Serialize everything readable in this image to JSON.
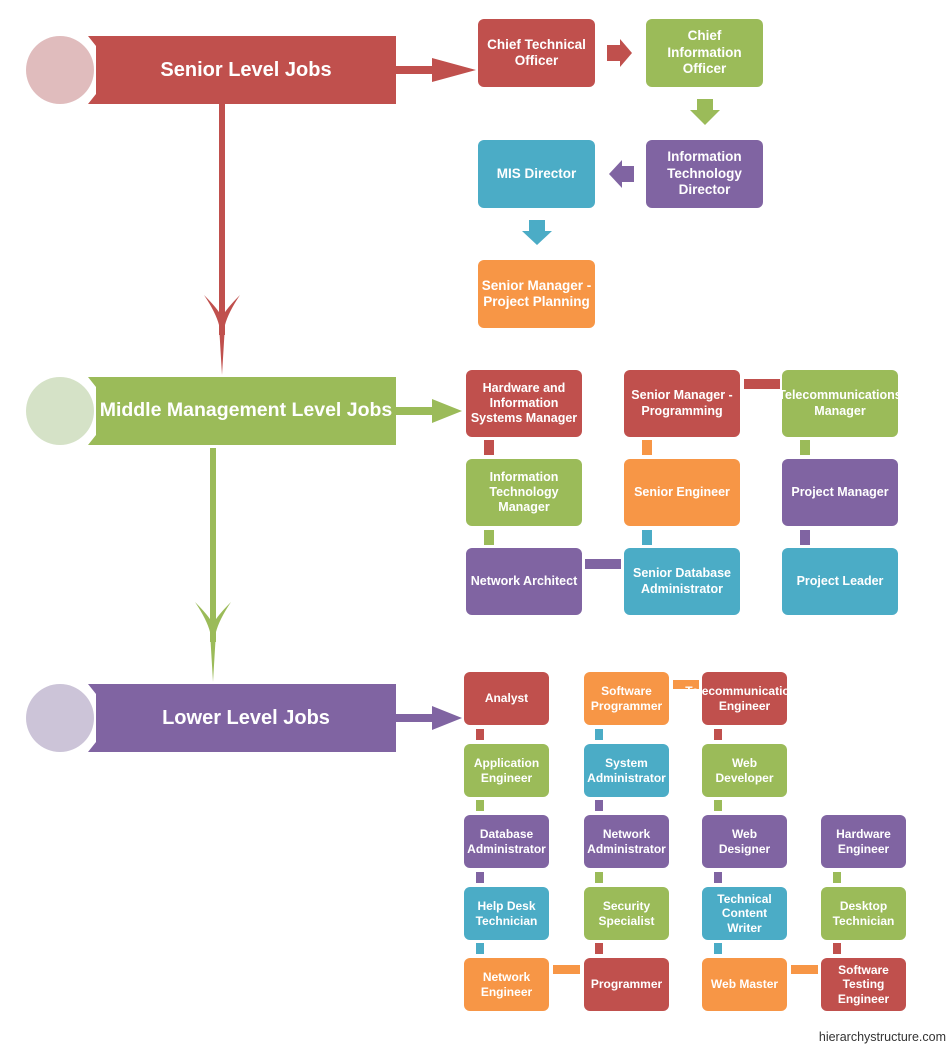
{
  "colors": {
    "red": "#c0504d",
    "green": "#9bbb59",
    "purple": "#8064a2",
    "blue": "#4bacc6",
    "orange": "#f79646",
    "red_light": "#e0bcbd",
    "green_light": "#d5e2c7",
    "purple_light": "#ccc4d8"
  },
  "levels": {
    "senior": {
      "title": "Senior Level Jobs",
      "jobs": [
        {
          "label": "Chief Technical Officer",
          "color": "red"
        },
        {
          "label": "Chief Information Officer",
          "color": "green"
        },
        {
          "label": "Information Technology Director",
          "color": "purple"
        },
        {
          "label": "MIS Director",
          "color": "blue"
        },
        {
          "label": "Senior Manager - Project Planning",
          "color": "orange"
        }
      ]
    },
    "middle": {
      "title": "Middle Management Level Jobs",
      "jobs": [
        {
          "label": "Hardware and Information Systems Manager",
          "color": "red"
        },
        {
          "label": "Information Technology Manager",
          "color": "green"
        },
        {
          "label": "Network Architect",
          "color": "purple"
        },
        {
          "label": "Senior Database Administrator",
          "color": "blue"
        },
        {
          "label": "Senior Engineer",
          "color": "orange"
        },
        {
          "label": "Senior Manager - Programming",
          "color": "red"
        },
        {
          "label": "Telecommunications Manager",
          "color": "green"
        },
        {
          "label": "Project Manager",
          "color": "purple"
        },
        {
          "label": "Project Leader",
          "color": "blue"
        }
      ]
    },
    "lower": {
      "title": "Lower Level Jobs",
      "jobs": [
        {
          "label": "Analyst",
          "color": "red"
        },
        {
          "label": "Application Engineer",
          "color": "green"
        },
        {
          "label": "Database Administrator",
          "color": "purple"
        },
        {
          "label": "Help Desk Technician",
          "color": "blue"
        },
        {
          "label": "Network Engineer",
          "color": "orange"
        },
        {
          "label": "Programmer",
          "color": "red"
        },
        {
          "label": "Security Specialist",
          "color": "green"
        },
        {
          "label": "Network Administrator",
          "color": "purple"
        },
        {
          "label": "System Administrator",
          "color": "blue"
        },
        {
          "label": "Software Programmer",
          "color": "orange"
        },
        {
          "label": "Telecommunications Engineer",
          "color": "red"
        },
        {
          "label": "Web Developer",
          "color": "green"
        },
        {
          "label": "Web Designer",
          "color": "purple"
        },
        {
          "label": "Technical Content Writer",
          "color": "blue"
        },
        {
          "label": "Web Master",
          "color": "orange"
        },
        {
          "label": "Software Testing Engineer",
          "color": "red"
        },
        {
          "label": "Desktop Technician",
          "color": "green"
        },
        {
          "label": "Hardware Engineer",
          "color": "purple"
        }
      ]
    }
  },
  "credit": "hierarchystructure.com"
}
